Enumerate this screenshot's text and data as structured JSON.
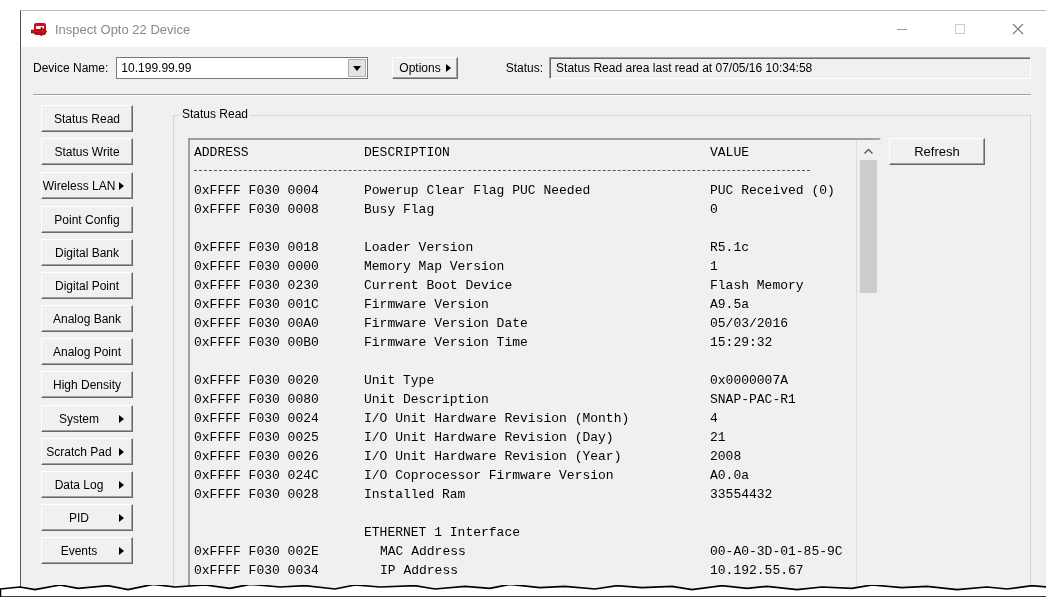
{
  "window": {
    "title": "Inspect Opto 22 Device"
  },
  "toolbar": {
    "device_label": "Device Name:",
    "device_value": "10.199.99.99",
    "options_button": "Options",
    "status_label": "Status:",
    "status_value": "Status Read area last read at 07/05/16 10:34:58"
  },
  "sidebar": {
    "groups": [
      {
        "buttons": [
          {
            "label": "Status Read",
            "submenu": false
          },
          {
            "label": "Status Write",
            "submenu": false
          }
        ]
      },
      {
        "buttons": [
          {
            "label": "Wireless LAN",
            "submenu": true
          }
        ]
      },
      {
        "buttons": [
          {
            "label": "Point Config",
            "submenu": false
          },
          {
            "label": "Digital Bank",
            "submenu": false
          },
          {
            "label": "Digital Point",
            "submenu": false
          },
          {
            "label": "Analog Bank",
            "submenu": false
          },
          {
            "label": "Analog Point",
            "submenu": false
          },
          {
            "label": "High Density",
            "submenu": false
          }
        ]
      },
      {
        "buttons": [
          {
            "label": "System",
            "submenu": true
          },
          {
            "label": "Scratch Pad",
            "submenu": true
          },
          {
            "label": "Data Log",
            "submenu": true
          },
          {
            "label": "PID",
            "submenu": true
          },
          {
            "label": "Events",
            "submenu": true
          }
        ]
      }
    ]
  },
  "panel": {
    "title": "Status Read",
    "refresh_button": "Refresh",
    "columns": [
      "ADDRESS",
      "DESCRIPTION",
      "VALUE"
    ],
    "rows": [
      {
        "kind": "entry",
        "address": "0xFFFF F030 0004",
        "description": "Powerup Clear Flag PUC Needed",
        "value": "PUC Received (0)"
      },
      {
        "kind": "entry",
        "address": "0xFFFF F030 0008",
        "description": "Busy Flag",
        "value": "0"
      },
      {
        "kind": "blank"
      },
      {
        "kind": "entry",
        "address": "0xFFFF F030 0018",
        "description": "Loader Version",
        "value": "R5.1c"
      },
      {
        "kind": "entry",
        "address": "0xFFFF F030 0000",
        "description": "Memory Map Version",
        "value": "1"
      },
      {
        "kind": "entry",
        "address": "0xFFFF F030 0230",
        "description": "Current Boot Device",
        "value": "Flash Memory"
      },
      {
        "kind": "entry",
        "address": "0xFFFF F030 001C",
        "description": "Firmware Version",
        "value": "A9.5a"
      },
      {
        "kind": "entry",
        "address": "0xFFFF F030 00A0",
        "description": "Firmware Version Date",
        "value": "05/03/2016"
      },
      {
        "kind": "entry",
        "address": "0xFFFF F030 00B0",
        "description": "Firmware Version Time",
        "value": "15:29:32"
      },
      {
        "kind": "blank"
      },
      {
        "kind": "entry",
        "address": "0xFFFF F030 0020",
        "description": "Unit Type",
        "value": "0x0000007A"
      },
      {
        "kind": "entry",
        "address": "0xFFFF F030 0080",
        "description": "Unit Description",
        "value": "SNAP-PAC-R1"
      },
      {
        "kind": "entry",
        "address": "0xFFFF F030 0024",
        "description": "I/O Unit Hardware Revision (Month)",
        "value": "4"
      },
      {
        "kind": "entry",
        "address": "0xFFFF F030 0025",
        "description": "I/O Unit Hardware Revision (Day)",
        "value": "21"
      },
      {
        "kind": "entry",
        "address": "0xFFFF F030 0026",
        "description": "I/O Unit Hardware Revision (Year)",
        "value": "2008"
      },
      {
        "kind": "entry",
        "address": "0xFFFF F030 024C",
        "description": "I/O Coprocessor Firmware Version",
        "value": "A0.0a"
      },
      {
        "kind": "entry",
        "address": "0xFFFF F030 0028",
        "description": "Installed Ram",
        "value": "33554432"
      },
      {
        "kind": "blank"
      },
      {
        "kind": "section",
        "description": "ETHERNET 1 Interface"
      },
      {
        "kind": "subentry",
        "address": "0xFFFF F030 002E",
        "description": "MAC Address",
        "value": "00-A0-3D-01-85-9C"
      },
      {
        "kind": "subentry",
        "address": "0xFFFF F030 0034",
        "description": "IP Address",
        "value": "10.192.55.67"
      }
    ]
  }
}
